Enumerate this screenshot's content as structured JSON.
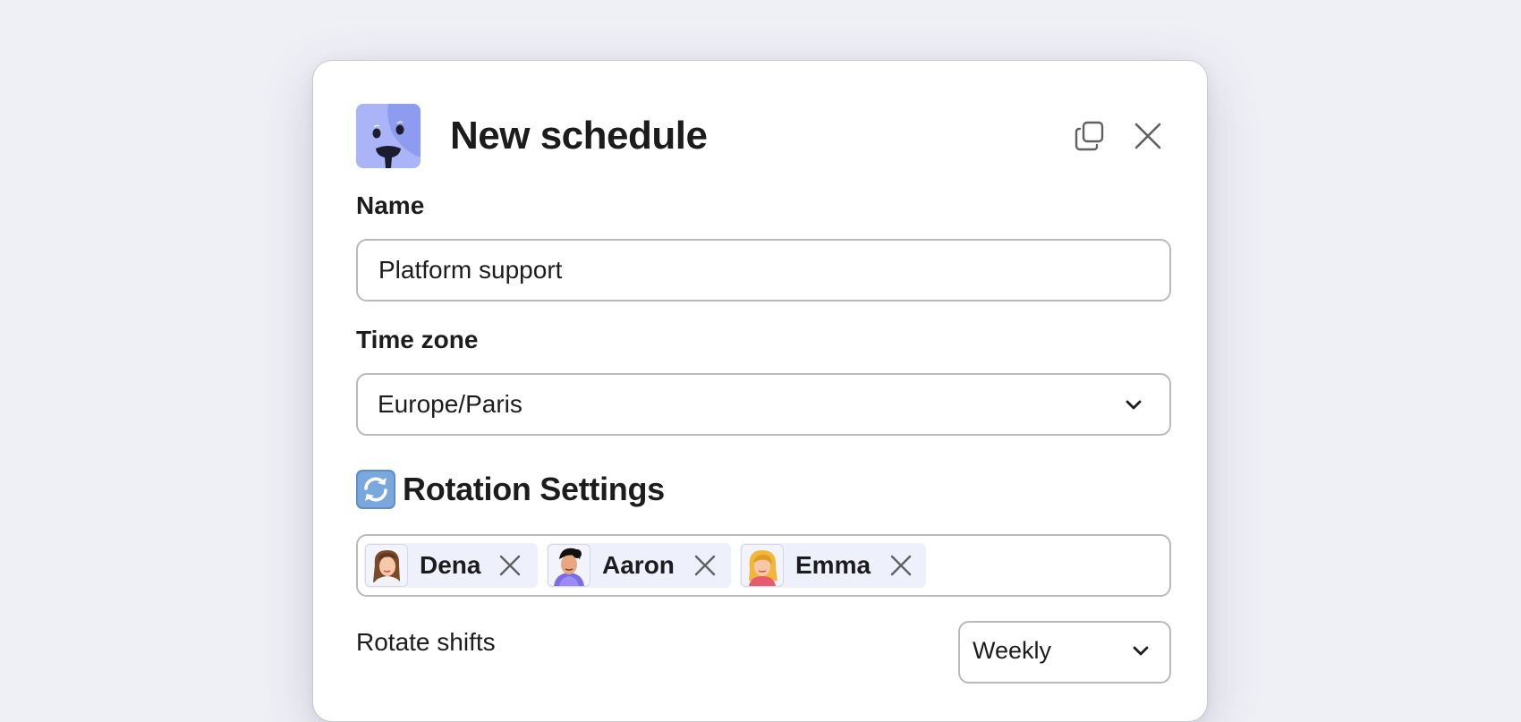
{
  "dialog": {
    "title": "New schedule",
    "app_icon": "dog-face-icon",
    "copy_icon": "copy-icon",
    "close_icon": "close-icon"
  },
  "name_field": {
    "label": "Name",
    "value": "Platform support"
  },
  "timezone_field": {
    "label": "Time zone",
    "value": "Europe/Paris"
  },
  "rotation": {
    "section_icon": "repeat-arrows-icon",
    "title": "Rotation Settings",
    "people": [
      {
        "name": "Dena",
        "avatar": "avatar-dena"
      },
      {
        "name": "Aaron",
        "avatar": "avatar-aaron"
      },
      {
        "name": "Emma",
        "avatar": "avatar-emma"
      }
    ],
    "rotate_label": "Rotate shifts",
    "frequency": "Weekly"
  },
  "colors": {
    "accent": "#8e9cf0",
    "chip_bg": "#eef0fb",
    "border": "#b9b9bd"
  }
}
